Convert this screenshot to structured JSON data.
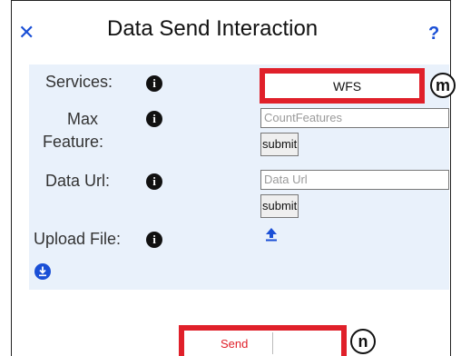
{
  "window": {
    "title": "Data Send Interaction",
    "close_icon": "close-icon",
    "help_label": "?"
  },
  "form": {
    "services": {
      "label": "Services:",
      "value": "WFS"
    },
    "max_feature": {
      "label_line1": "Max",
      "label_line2": "Feature:",
      "placeholder": "CountFeatures",
      "submit_label": "submit"
    },
    "data_url": {
      "label": "Data Url:",
      "placeholder": "Data Url",
      "submit_label": "submit"
    },
    "upload_file": {
      "label": "Upload File:",
      "icon": "upload-icon"
    },
    "download_icon": "download-icon"
  },
  "footer": {
    "send_label": "Send"
  },
  "callouts": {
    "m": "m",
    "n": "n"
  },
  "colors": {
    "accent": "#1a4fd6",
    "highlight": "#e0202a",
    "panel": "#e9f1fb",
    "send_text": "#e0202a"
  }
}
